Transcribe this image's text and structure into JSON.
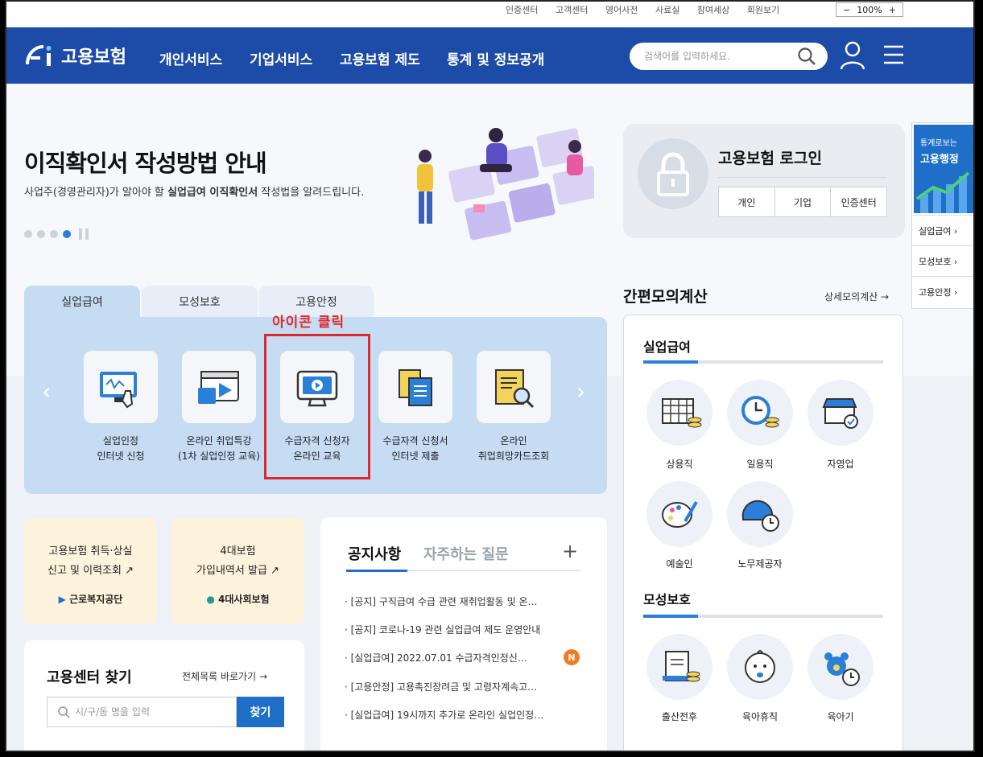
{
  "utility": {
    "links": [
      "인증센터",
      "고객센터",
      "영어사전",
      "사료실",
      "참여세상",
      "회원보기"
    ],
    "zoom_minus": "−",
    "zoom_value": "100%",
    "zoom_plus": "+"
  },
  "nav": {
    "logo_text": "고용보험",
    "menu": [
      "개인서비스",
      "기업서비스",
      "고용보험 제도",
      "통계 및 정보공개"
    ],
    "search_placeholder": "검색어를 입력하세요."
  },
  "hero": {
    "title": "이직확인서 작성방법 안내",
    "subtitle_prefix": "사업주(경영관리자)가 알아야 할 ",
    "subtitle_bold1": "실업급여 이직확인서",
    "subtitle_suffix": " 작성법을 알려드립니다.",
    "active_slide": 4,
    "slide_count": 4
  },
  "login": {
    "title": "고용보험 로그인",
    "buttons": [
      "개인",
      "기업",
      "인증센터"
    ]
  },
  "side": {
    "banner_line1": "통계로보는",
    "banner_line2": "고용행정",
    "items": [
      "실업급여 ›",
      "모성보호 ›",
      "고용안정 ›"
    ]
  },
  "tabs": [
    "실업급여",
    "모성보호",
    "고용안정"
  ],
  "services": [
    {
      "line1": "실업인정",
      "line2": "인터넷 신청",
      "icon": "monitor-hand-icon"
    },
    {
      "line1": "온라인 취업특강",
      "line2": "(1차 실업인정 교육)",
      "icon": "video-lecture-icon"
    },
    {
      "line1": "수급자격 신청자",
      "line2": "온라인 교육",
      "icon": "play-monitor-icon"
    },
    {
      "line1": "수급자격 신청서",
      "line2": "인터넷 제출",
      "icon": "documents-icon"
    },
    {
      "line1": "온라인",
      "line2": "취업희망카드조회",
      "icon": "document-search-icon"
    }
  ],
  "annotation": "아이콘 클릭",
  "quick": [
    {
      "line1": "고용보험 취득·상실",
      "line2": "신고 및 이력조회 ↗",
      "org": "근로복지공단"
    },
    {
      "line1": "4대보험",
      "line2": "가입내역서 발급 ↗",
      "org": "4대사회보험"
    }
  ],
  "finder": {
    "title": "고용센터 찾기",
    "link": "전체목록 바로가기 →",
    "placeholder": "시/구/동 명을 입력",
    "button": "찾기"
  },
  "notice": {
    "tab_active": "공지사항",
    "tab_inactive": "자주하는 질문",
    "plus": "+",
    "items": [
      "· [공지] 구직급여 수급 관련 재취업활동 및 온…",
      "· [공지] 코로나-19 관련 실업급여 제도 운영안내",
      "· [실업급여] 2022.07.01 수급자격인정신…",
      "· [고용안정] 고용촉진장려금 및 고령자계속고…",
      "· [실업급여] 19시까지 추가로 온라인 실업인정…"
    ],
    "new_badge": "N"
  },
  "calculator": {
    "title": "간편모의계산",
    "link": "상세모의계산 →",
    "section1": "실업급여",
    "section1_items": [
      "상용직",
      "일용직",
      "자영업",
      "예술인",
      "노무제공자"
    ],
    "section2": "모성보호",
    "section2_items": [
      "출산전후",
      "육아휴직",
      "육아기"
    ]
  }
}
